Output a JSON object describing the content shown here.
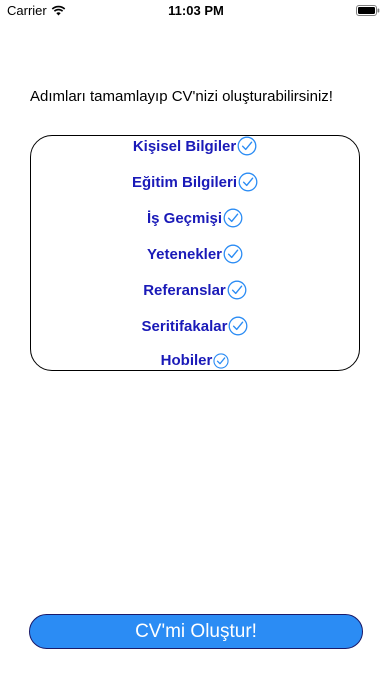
{
  "status_bar": {
    "carrier": "Carrier",
    "time": "11:03 PM"
  },
  "intro_text": "Adımları tamamlayıp CV'nizi oluşturabilirsiniz!",
  "steps": [
    {
      "label": "Kişisel Bilgiler",
      "completed": true
    },
    {
      "label": "Eğitim Bilgileri",
      "completed": true
    },
    {
      "label": "İş Geçmişi",
      "completed": true
    },
    {
      "label": "Yetenekler",
      "completed": true
    },
    {
      "label": "Referanslar",
      "completed": true
    },
    {
      "label": "Seritifakalar",
      "completed": true
    },
    {
      "label": "Hobiler",
      "completed": true
    }
  ],
  "create_button_label": "CV'mi Oluştur!",
  "colors": {
    "step_text": "#1a1ab8",
    "check": "#2b8cf4",
    "button_bg": "#2b8cf4"
  }
}
